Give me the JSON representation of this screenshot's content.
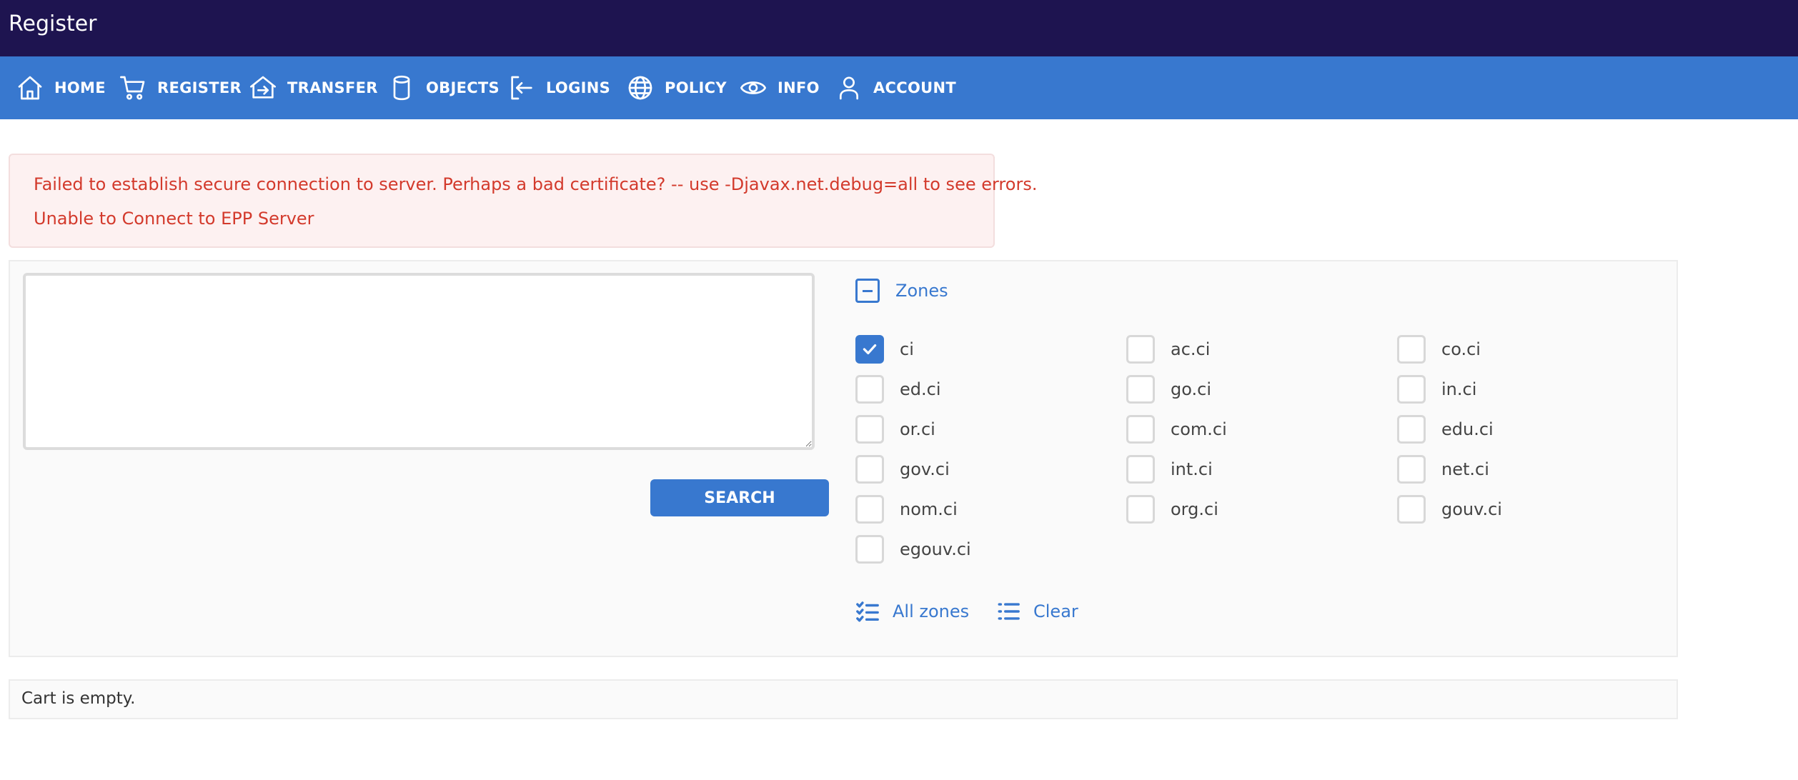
{
  "app": {
    "title": "Register"
  },
  "nav": {
    "items": [
      {
        "label": "HOME",
        "icon": "home-icon"
      },
      {
        "label": "REGISTER",
        "icon": "cart-icon"
      },
      {
        "label": "TRANSFER",
        "icon": "transfer-icon"
      },
      {
        "label": "OBJECTS",
        "icon": "database-icon"
      },
      {
        "label": "LOGINS",
        "icon": "login-icon"
      },
      {
        "label": "POLICY",
        "icon": "globe-icon"
      },
      {
        "label": "INFO",
        "icon": "eye-icon"
      },
      {
        "label": "ACCOUNT",
        "icon": "user-icon"
      }
    ]
  },
  "alert": {
    "lines": [
      "Failed to establish secure connection to server. Perhaps a bad certificate? -- use -Djavax.net.debug=all to see errors.",
      "Unable to Connect to EPP Server"
    ],
    "color": "#d33a2c"
  },
  "search": {
    "query_value": "",
    "button_label": "SEARCH"
  },
  "zones": {
    "toggle_label": "Zones",
    "items": [
      {
        "label": "ci",
        "checked": true
      },
      {
        "label": "ac.ci",
        "checked": false
      },
      {
        "label": "co.ci",
        "checked": false
      },
      {
        "label": "ed.ci",
        "checked": false
      },
      {
        "label": "go.ci",
        "checked": false
      },
      {
        "label": "in.ci",
        "checked": false
      },
      {
        "label": "or.ci",
        "checked": false
      },
      {
        "label": "com.ci",
        "checked": false
      },
      {
        "label": "edu.ci",
        "checked": false
      },
      {
        "label": "gov.ci",
        "checked": false
      },
      {
        "label": "int.ci",
        "checked": false
      },
      {
        "label": "net.ci",
        "checked": false
      },
      {
        "label": "nom.ci",
        "checked": false
      },
      {
        "label": "org.ci",
        "checked": false
      },
      {
        "label": "gouv.ci",
        "checked": false
      },
      {
        "label": "egouv.ci",
        "checked": false
      }
    ],
    "all_zones_label": "All zones",
    "clear_label": "Clear"
  },
  "cart": {
    "status": "Cart is empty."
  },
  "colors": {
    "title_bar": "#1e1450",
    "nav_bar": "#3878cf",
    "accent": "#3878cf"
  }
}
